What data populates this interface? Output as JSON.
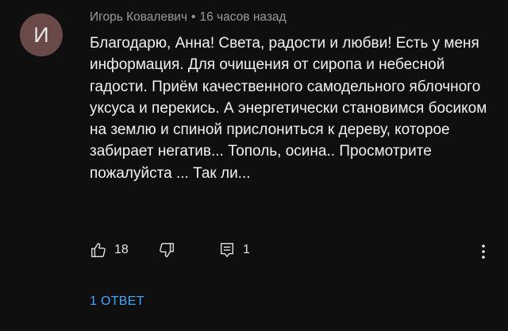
{
  "comment": {
    "avatar_letter": "И",
    "author": "Игорь Ковалевич",
    "separator": "•",
    "time": "16 часов назад",
    "text": "Благодарю, Анна! Света, радости и любви! Есть у меня информация. Для очищения от сиропа и небесной гадости. Приём качественного самодельного яблочного уксуса  и перекись. А энергетически становимся босиком на землю и спиной прислониться к дереву, которое забирает негатив... Тополь, осина..  Просмотрите пожалуйста ... Так ли...",
    "likes": "18",
    "replies_count": "1",
    "replies_link": "1 ОТВЕТ"
  },
  "colors": {
    "background": "#0f0f0f",
    "avatar": "#6a4a48",
    "link": "#3ea6ff"
  },
  "icons": [
    "thumb-up-icon",
    "thumb-down-icon",
    "reply-icon",
    "more-vert-icon"
  ]
}
